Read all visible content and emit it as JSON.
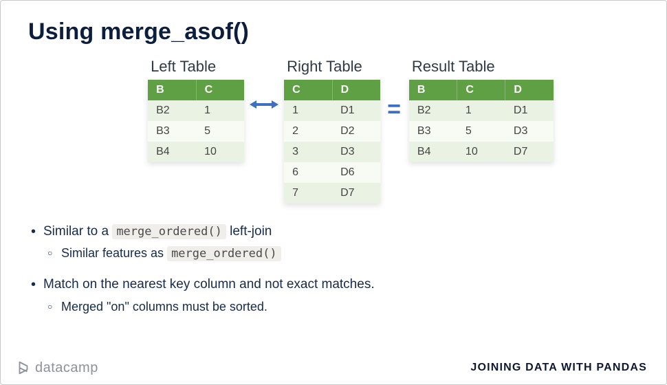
{
  "title": "Using merge_asof()",
  "chart_data": {
    "type": "table",
    "tables": [
      {
        "caption": "Left Table",
        "columns": [
          "B",
          "C"
        ],
        "rows": [
          [
            "B2",
            "1"
          ],
          [
            "B3",
            "5"
          ],
          [
            "B4",
            "10"
          ]
        ]
      },
      {
        "caption": "Right Table",
        "columns": [
          "C",
          "D"
        ],
        "rows": [
          [
            "1",
            "D1"
          ],
          [
            "2",
            "D2"
          ],
          [
            "3",
            "D3"
          ],
          [
            "6",
            "D6"
          ],
          [
            "7",
            "D7"
          ]
        ]
      },
      {
        "caption": "Result Table",
        "columns": [
          "B",
          "C",
          "D"
        ],
        "rows": [
          [
            "B2",
            "1",
            "D1"
          ],
          [
            "B3",
            "5",
            "D3"
          ],
          [
            "B4",
            "10",
            "D7"
          ]
        ]
      }
    ],
    "equals_symbol": "="
  },
  "bullets": {
    "b1_pre": "Similar to a ",
    "b1_code": "merge_ordered()",
    "b1_post": " left-join",
    "b1_sub_pre": "Similar features as ",
    "b1_sub_code": "merge_ordered()",
    "b2": "Match on the nearest key column and not exact matches.",
    "b2_sub": "Merged \"on\" columns must be sorted."
  },
  "footer": {
    "brand": "datacamp",
    "course": "JOINING DATA WITH PANDAS"
  }
}
